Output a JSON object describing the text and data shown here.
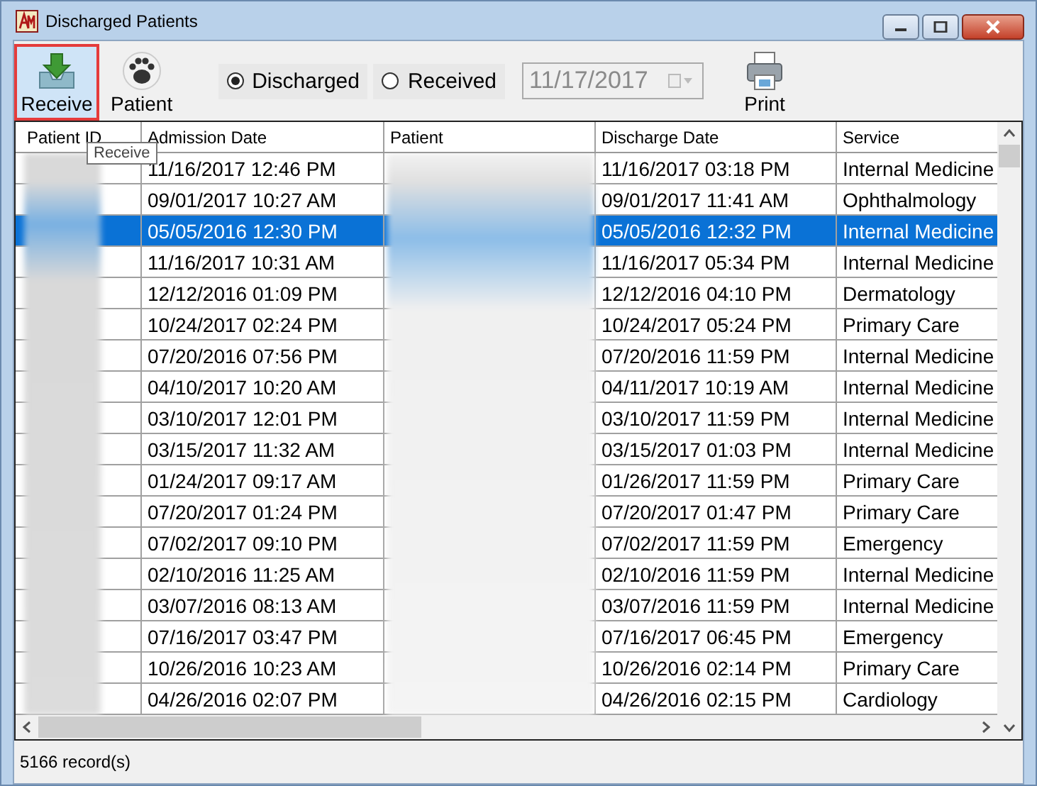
{
  "window": {
    "title": "Discharged Patients"
  },
  "toolbar": {
    "buttons": [
      {
        "label": "Receive",
        "kind": "receive",
        "highlighted": true
      },
      {
        "label": "Patient",
        "kind": "patient",
        "highlighted": false
      }
    ],
    "filter": [
      {
        "label": "Discharged",
        "selected": true
      },
      {
        "label": "Received",
        "selected": false
      }
    ],
    "date_field": {
      "value": "11/17/2017",
      "disabled": true
    },
    "print_button": {
      "label": "Print"
    }
  },
  "tooltip": "Receive",
  "table": {
    "columns": [
      "Patient ID",
      "Admission Date",
      "Patient",
      "Discharge Date",
      "Service"
    ],
    "rows": [
      {
        "admission": "11/16/2017 12:46 PM",
        "discharge": "11/16/2017 03:18 PM",
        "service": "Internal Medicine",
        "selected": false
      },
      {
        "admission": "09/01/2017 10:27 AM",
        "discharge": "09/01/2017 11:41 AM",
        "service": "Ophthalmology",
        "selected": false
      },
      {
        "admission": "05/05/2016 12:30 PM",
        "discharge": "05/05/2016 12:32 PM",
        "service": "Internal Medicine",
        "selected": true
      },
      {
        "admission": "11/16/2017 10:31 AM",
        "discharge": "11/16/2017 05:34 PM",
        "service": "Internal Medicine",
        "selected": false
      },
      {
        "admission": "12/12/2016 01:09 PM",
        "discharge": "12/12/2016 04:10 PM",
        "service": "Dermatology",
        "selected": false
      },
      {
        "admission": "10/24/2017 02:24 PM",
        "discharge": "10/24/2017 05:24 PM",
        "service": "Primary Care",
        "selected": false
      },
      {
        "admission": "07/20/2016 07:56 PM",
        "discharge": "07/20/2016 11:59 PM",
        "service": "Internal Medicine",
        "selected": false
      },
      {
        "admission": "04/10/2017 10:20 AM",
        "discharge": "04/11/2017 10:19 AM",
        "service": "Internal Medicine",
        "selected": false
      },
      {
        "admission": "03/10/2017 12:01 PM",
        "discharge": "03/10/2017 11:59 PM",
        "service": "Internal Medicine",
        "selected": false
      },
      {
        "admission": "03/15/2017 11:32 AM",
        "discharge": "03/15/2017 01:03 PM",
        "service": "Internal Medicine",
        "selected": false
      },
      {
        "admission": "01/24/2017 09:17 AM",
        "discharge": "01/26/2017 11:59 PM",
        "service": "Primary Care",
        "selected": false
      },
      {
        "admission": "07/20/2017 01:24 PM",
        "discharge": "07/20/2017 01:47 PM",
        "service": "Primary Care",
        "selected": false
      },
      {
        "admission": "07/02/2017 09:10 PM",
        "discharge": "07/02/2017 11:59 PM",
        "service": "Emergency",
        "selected": false
      },
      {
        "admission": "02/10/2016 11:25 AM",
        "discharge": "02/10/2016 11:59 PM",
        "service": "Internal Medicine",
        "selected": false
      },
      {
        "admission": "03/07/2016 08:13 AM",
        "discharge": "03/07/2016 11:59 PM",
        "service": "Internal Medicine",
        "selected": false
      },
      {
        "admission": "07/16/2017 03:47 PM",
        "discharge": "07/16/2017 06:45 PM",
        "service": "Emergency",
        "selected": false
      },
      {
        "admission": "10/26/2016 10:23 AM",
        "discharge": "10/26/2016 02:14 PM",
        "service": "Primary Care",
        "selected": false
      },
      {
        "admission": "04/26/2016 02:07 PM",
        "discharge": "04/26/2016 02:15 PM",
        "service": "Cardiology",
        "selected": false
      }
    ]
  },
  "status_bar": "5166 record(s)"
}
